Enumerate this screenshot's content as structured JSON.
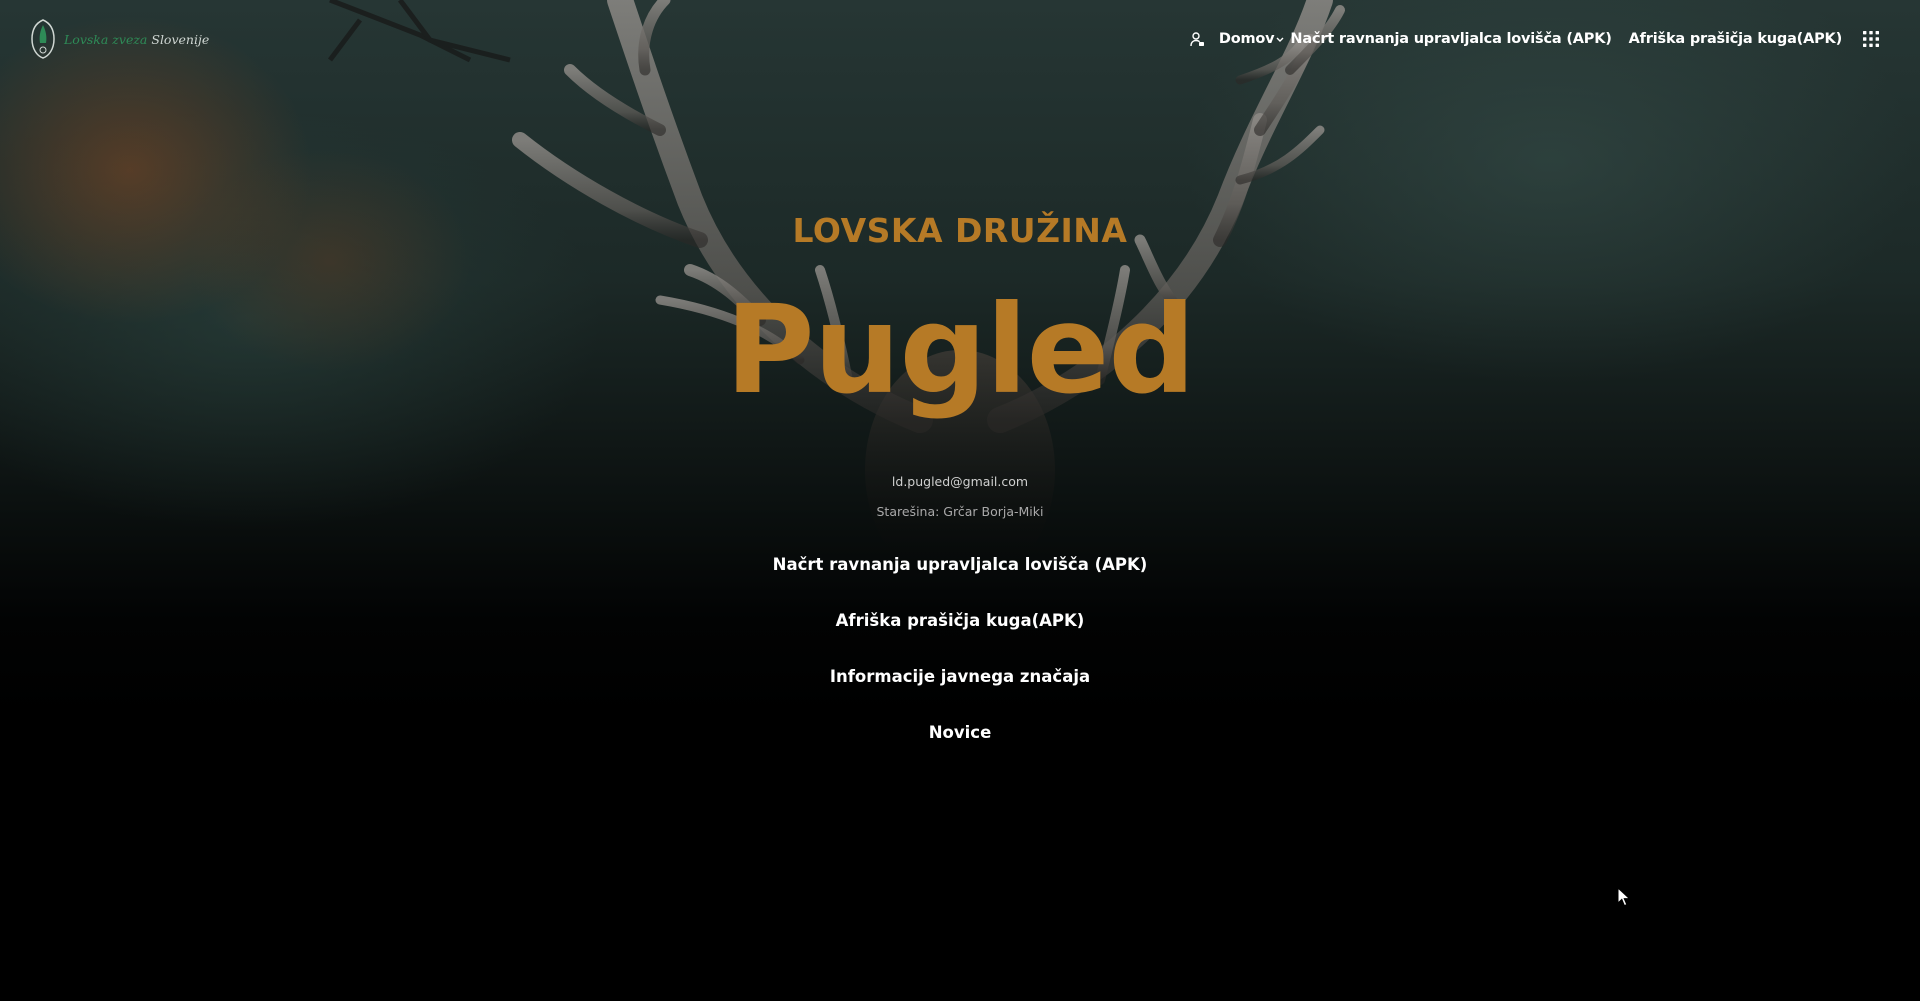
{
  "header": {
    "logo": {
      "text_green": "Lovska zveza",
      "text_gray": "Slovenije"
    },
    "nav": {
      "user_icon": "user-icon",
      "home_label": "Domov",
      "caret_icon": "chevron-down-icon",
      "item_1": "Načrt ravnanja upravljalca lovišča (APK)",
      "item_2": "Afriška prašičja kuga(APK)",
      "menu_icon": "grid-menu-icon"
    }
  },
  "hero": {
    "eyebrow": "LOVSKA DRUŽINA",
    "title": "Pugled",
    "email": "ld.pugled@gmail.com",
    "leader": "Starešina: Grčar Borja-Miki",
    "links": [
      "Načrt ravnanja upravljalca lovišča (APK)",
      "Afriška prašičja kuga(APK)",
      "Informacije javnega značaja",
      "Novice"
    ]
  },
  "colors": {
    "accent": "#b67a26",
    "text": "#ffffff",
    "background": "#000000",
    "logo_green": "#2e8b57"
  }
}
